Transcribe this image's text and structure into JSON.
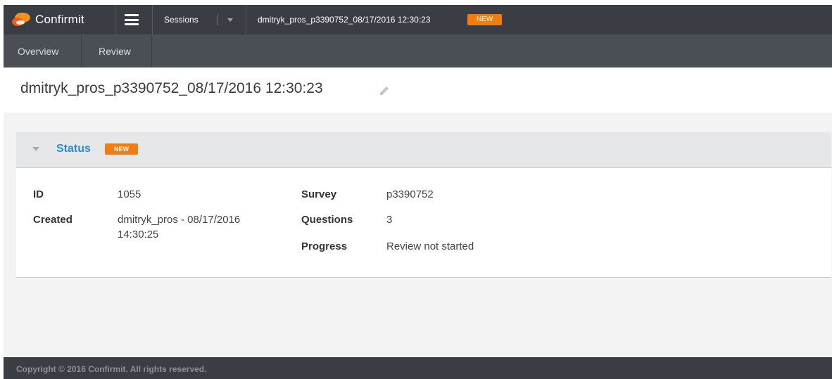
{
  "header": {
    "brand": "Confirmit",
    "breadcrumb_sessions": "Sessions",
    "current_session": "dmitryk_pros_p3390752_08/17/2016 12:30:23",
    "status_badge": "NEW"
  },
  "subnav": {
    "tabs": [
      {
        "label": "Overview"
      },
      {
        "label": "Review"
      }
    ]
  },
  "page": {
    "title": "dmitryk_pros_p3390752_08/17/2016 12:30:23"
  },
  "status_card": {
    "title": "Status",
    "badge": "NEW",
    "fields_left": [
      {
        "label": "ID",
        "value": "1055"
      },
      {
        "label": "Created",
        "value": "dmitryk_pros - 08/17/2016 14:30:25"
      }
    ],
    "fields_right": [
      {
        "label": "Survey",
        "value": "p3390752"
      },
      {
        "label": "Questions",
        "value": "3"
      },
      {
        "label": "Progress",
        "value": "Review not started"
      }
    ]
  },
  "footer": {
    "copyright": "Copyright © 2016 Confirmit. All rights reserved."
  },
  "colors": {
    "accent": "#2a8fc7",
    "badge": "#f07d0f",
    "topbar": "#3a3e44",
    "subnav": "#4a4f55"
  },
  "icons": {
    "logo": "confirmit-logo-icon",
    "menu": "hamburger-menu-icon",
    "dropdown": "chevron-down-icon",
    "edit": "pencil-icon",
    "collapse": "caret-down-icon"
  }
}
